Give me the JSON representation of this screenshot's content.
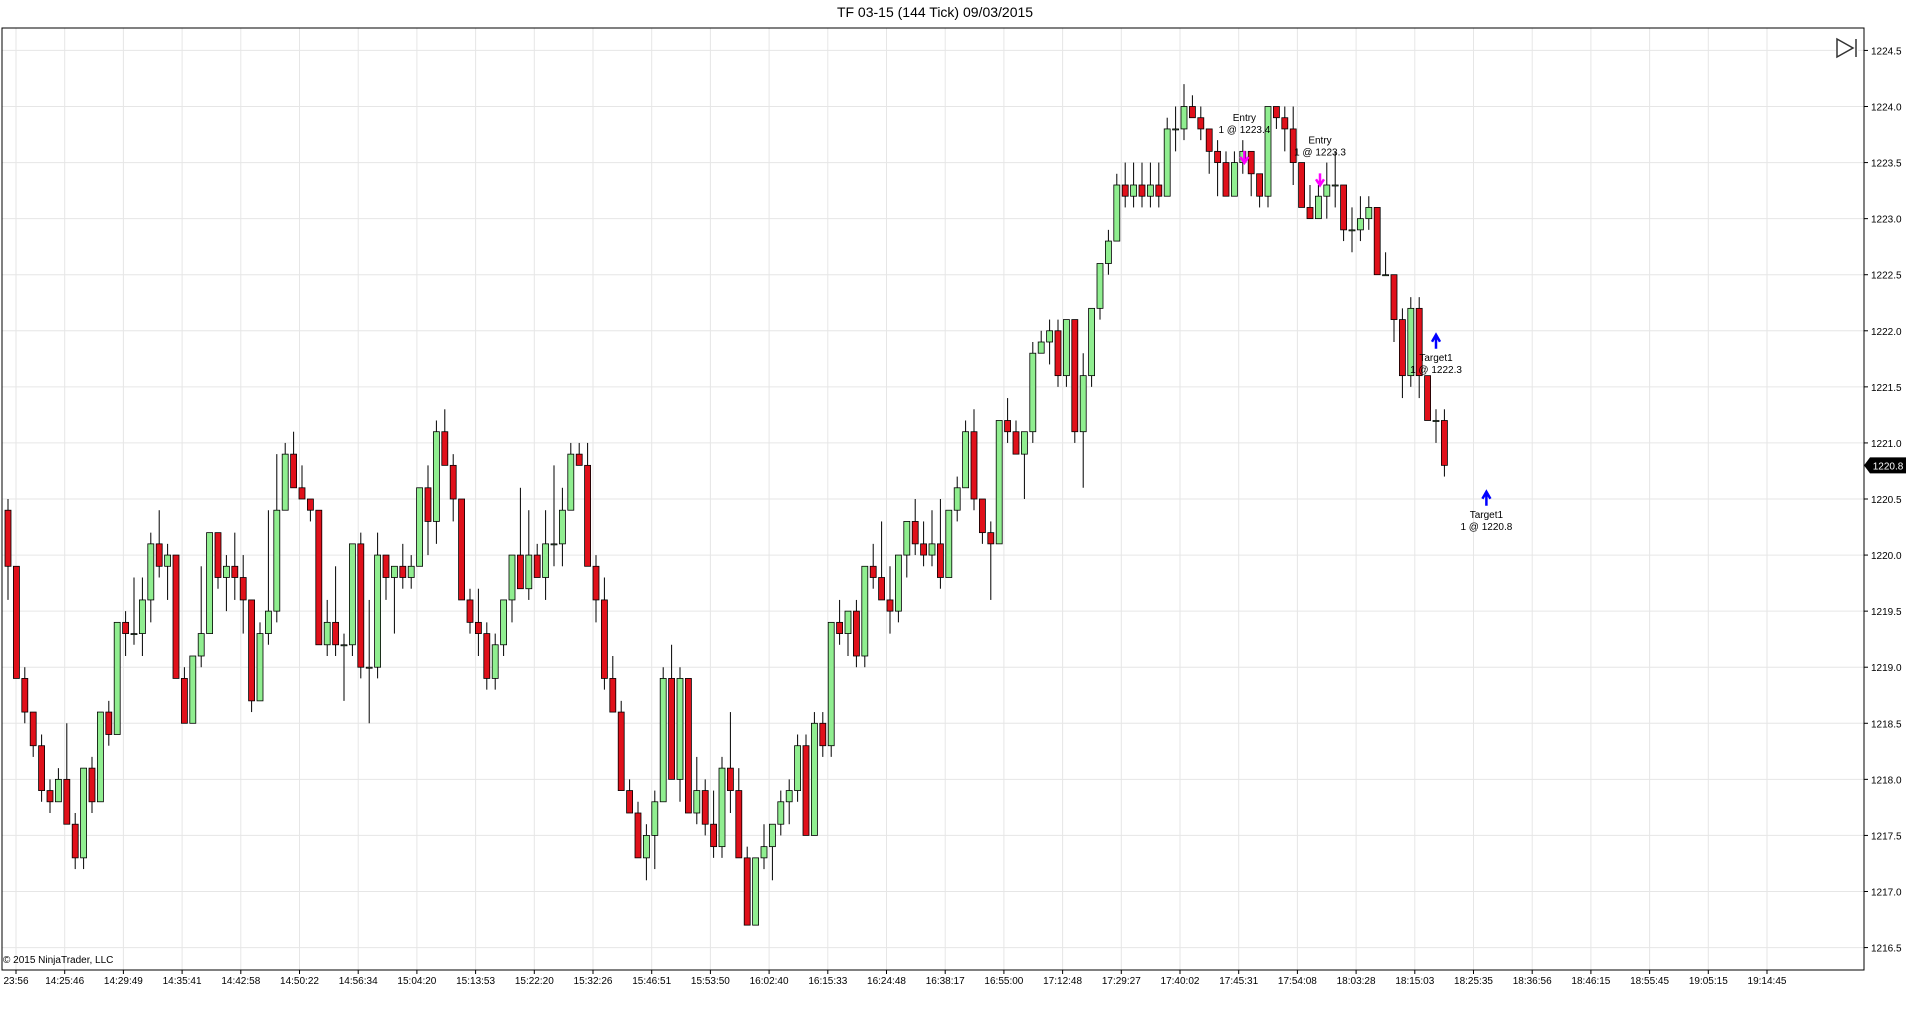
{
  "title": "TF 03-15 (144 Tick)  09/03/2015",
  "copyright": "© 2015 NinjaTrader, LLC",
  "colors": {
    "up": "#90EE90",
    "down": "#E0101A",
    "grid": "#E6E6E6",
    "border": "#000000",
    "entry_arrow": "#FF00FF",
    "target_arrow": "#0000FF",
    "last_price_bg": "#000000"
  },
  "icons": {
    "toggle_panel": "play-bar-icon"
  },
  "chart_data": {
    "type": "candlestick",
    "title": "TF 03-15 (144 Tick)  09/03/2015",
    "ylim": [
      1216.3,
      1224.7
    ],
    "yticks": [
      "1216.5",
      "1217.0",
      "1217.5",
      "1218.0",
      "1218.5",
      "1219.0",
      "1219.5",
      "1220.0",
      "1220.5",
      "1221.0",
      "1221.5",
      "1222.0",
      "1222.5",
      "1223.0",
      "1223.5",
      "1224.0",
      "1224.5"
    ],
    "xticks": [
      "23:56",
      "14:25:46",
      "14:29:49",
      "14:35:41",
      "14:42:58",
      "14:50:22",
      "14:56:34",
      "15:04:20",
      "15:13:53",
      "15:22:20",
      "15:32:26",
      "15:46:51",
      "15:53:50",
      "16:02:40",
      "16:15:33",
      "16:24:48",
      "16:38:17",
      "16:55:00",
      "17:12:48",
      "17:29:27",
      "17:40:02",
      "17:45:31",
      "17:54:08",
      "18:03:28",
      "18:15:03",
      "18:25:35",
      "18:36:56",
      "18:46:15",
      "18:55:45",
      "19:05:15",
      "19:14:45"
    ],
    "grid": true,
    "last_price": "1220.8",
    "candles": [
      {
        "o": 1220.4,
        "h": 1220.5,
        "l": 1219.6,
        "c": 1219.9
      },
      {
        "o": 1219.9,
        "h": 1219.9,
        "l": 1218.9,
        "c": 1218.9
      },
      {
        "o": 1218.9,
        "h": 1219.0,
        "l": 1218.5,
        "c": 1218.6
      },
      {
        "o": 1218.6,
        "h": 1218.6,
        "l": 1218.2,
        "c": 1218.3
      },
      {
        "o": 1218.3,
        "h": 1218.4,
        "l": 1217.8,
        "c": 1217.9
      },
      {
        "o": 1217.9,
        "h": 1218.0,
        "l": 1217.7,
        "c": 1217.8
      },
      {
        "o": 1217.8,
        "h": 1218.1,
        "l": 1217.8,
        "c": 1218.0
      },
      {
        "o": 1218.0,
        "h": 1218.5,
        "l": 1217.6,
        "c": 1217.6
      },
      {
        "o": 1217.6,
        "h": 1217.7,
        "l": 1217.2,
        "c": 1217.3
      },
      {
        "o": 1217.3,
        "h": 1218.0,
        "l": 1217.2,
        "c": 1218.1
      },
      {
        "o": 1218.1,
        "h": 1218.2,
        "l": 1217.7,
        "c": 1217.8
      },
      {
        "o": 1217.8,
        "h": 1218.6,
        "l": 1217.8,
        "c": 1218.6
      },
      {
        "o": 1218.6,
        "h": 1218.7,
        "l": 1218.3,
        "c": 1218.4
      },
      {
        "o": 1218.4,
        "h": 1219.4,
        "l": 1218.4,
        "c": 1219.4
      },
      {
        "o": 1219.4,
        "h": 1219.5,
        "l": 1219.1,
        "c": 1219.3
      },
      {
        "o": 1219.3,
        "h": 1219.8,
        "l": 1219.2,
        "c": 1219.3
      },
      {
        "o": 1219.3,
        "h": 1219.8,
        "l": 1219.1,
        "c": 1219.6
      },
      {
        "o": 1219.6,
        "h": 1220.2,
        "l": 1219.4,
        "c": 1220.1
      },
      {
        "o": 1220.1,
        "h": 1220.4,
        "l": 1219.8,
        "c": 1219.9
      },
      {
        "o": 1219.9,
        "h": 1220.1,
        "l": 1219.6,
        "c": 1220.0
      },
      {
        "o": 1220.0,
        "h": 1220.0,
        "l": 1218.9,
        "c": 1218.9
      },
      {
        "o": 1218.9,
        "h": 1219.0,
        "l": 1218.5,
        "c": 1218.5
      },
      {
        "o": 1218.5,
        "h": 1219.1,
        "l": 1218.5,
        "c": 1219.1
      },
      {
        "o": 1219.1,
        "h": 1219.9,
        "l": 1219.0,
        "c": 1219.3
      },
      {
        "o": 1219.3,
        "h": 1220.2,
        "l": 1219.3,
        "c": 1220.2
      },
      {
        "o": 1220.2,
        "h": 1220.2,
        "l": 1219.7,
        "c": 1219.8
      },
      {
        "o": 1219.8,
        "h": 1220.0,
        "l": 1219.5,
        "c": 1219.9
      },
      {
        "o": 1219.9,
        "h": 1220.2,
        "l": 1219.6,
        "c": 1219.8
      },
      {
        "o": 1219.8,
        "h": 1220.0,
        "l": 1219.3,
        "c": 1219.6
      },
      {
        "o": 1219.6,
        "h": 1219.6,
        "l": 1218.6,
        "c": 1218.7
      },
      {
        "o": 1218.7,
        "h": 1219.4,
        "l": 1218.7,
        "c": 1219.3
      },
      {
        "o": 1219.3,
        "h": 1220.4,
        "l": 1219.2,
        "c": 1219.5
      },
      {
        "o": 1219.5,
        "h": 1220.9,
        "l": 1219.4,
        "c": 1220.4
      },
      {
        "o": 1220.4,
        "h": 1221.0,
        "l": 1220.4,
        "c": 1220.9
      },
      {
        "o": 1220.9,
        "h": 1221.1,
        "l": 1220.6,
        "c": 1220.6
      },
      {
        "o": 1220.6,
        "h": 1220.8,
        "l": 1220.5,
        "c": 1220.5
      },
      {
        "o": 1220.5,
        "h": 1220.5,
        "l": 1220.3,
        "c": 1220.4
      },
      {
        "o": 1220.4,
        "h": 1220.4,
        "l": 1219.2,
        "c": 1219.2
      },
      {
        "o": 1219.2,
        "h": 1219.6,
        "l": 1219.1,
        "c": 1219.4
      },
      {
        "o": 1219.4,
        "h": 1219.9,
        "l": 1219.1,
        "c": 1219.2
      },
      {
        "o": 1219.2,
        "h": 1219.3,
        "l": 1218.7,
        "c": 1219.2
      },
      {
        "o": 1219.2,
        "h": 1219.8,
        "l": 1219.1,
        "c": 1220.1
      },
      {
        "o": 1220.1,
        "h": 1220.2,
        "l": 1218.9,
        "c": 1219.0
      },
      {
        "o": 1219.0,
        "h": 1219.6,
        "l": 1218.5,
        "c": 1219.0
      },
      {
        "o": 1219.0,
        "h": 1220.2,
        "l": 1218.9,
        "c": 1220.0
      },
      {
        "o": 1220.0,
        "h": 1220.0,
        "l": 1219.6,
        "c": 1219.8
      },
      {
        "o": 1219.8,
        "h": 1219.9,
        "l": 1219.3,
        "c": 1219.9
      },
      {
        "o": 1219.9,
        "h": 1220.1,
        "l": 1219.7,
        "c": 1219.8
      },
      {
        "o": 1219.8,
        "h": 1220.0,
        "l": 1219.7,
        "c": 1219.9
      },
      {
        "o": 1219.9,
        "h": 1220.6,
        "l": 1219.9,
        "c": 1220.6
      },
      {
        "o": 1220.6,
        "h": 1220.8,
        "l": 1220.0,
        "c": 1220.3
      },
      {
        "o": 1220.3,
        "h": 1221.2,
        "l": 1220.1,
        "c": 1221.1
      },
      {
        "o": 1221.1,
        "h": 1221.3,
        "l": 1220.9,
        "c": 1220.8
      },
      {
        "o": 1220.8,
        "h": 1220.9,
        "l": 1220.3,
        "c": 1220.5
      },
      {
        "o": 1220.5,
        "h": 1220.5,
        "l": 1219.6,
        "c": 1219.6
      },
      {
        "o": 1219.6,
        "h": 1219.7,
        "l": 1219.3,
        "c": 1219.4
      },
      {
        "o": 1219.4,
        "h": 1219.7,
        "l": 1219.1,
        "c": 1219.3
      },
      {
        "o": 1219.3,
        "h": 1219.4,
        "l": 1218.8,
        "c": 1218.9
      },
      {
        "o": 1218.9,
        "h": 1219.3,
        "l": 1218.8,
        "c": 1219.2
      },
      {
        "o": 1219.2,
        "h": 1219.5,
        "l": 1219.1,
        "c": 1219.6
      },
      {
        "o": 1219.6,
        "h": 1220.0,
        "l": 1219.4,
        "c": 1220.0
      },
      {
        "o": 1220.0,
        "h": 1220.6,
        "l": 1219.7,
        "c": 1219.7
      },
      {
        "o": 1219.7,
        "h": 1220.4,
        "l": 1219.6,
        "c": 1220.0
      },
      {
        "o": 1220.0,
        "h": 1220.1,
        "l": 1219.8,
        "c": 1219.8
      },
      {
        "o": 1219.8,
        "h": 1220.4,
        "l": 1219.6,
        "c": 1220.1
      },
      {
        "o": 1220.1,
        "h": 1220.8,
        "l": 1219.9,
        "c": 1220.1
      },
      {
        "o": 1220.1,
        "h": 1220.6,
        "l": 1219.9,
        "c": 1220.4
      },
      {
        "o": 1220.4,
        "h": 1221.0,
        "l": 1220.4,
        "c": 1220.9
      },
      {
        "o": 1220.9,
        "h": 1221.0,
        "l": 1220.8,
        "c": 1220.8
      },
      {
        "o": 1220.8,
        "h": 1221.0,
        "l": 1219.9,
        "c": 1219.9
      },
      {
        "o": 1219.9,
        "h": 1220.0,
        "l": 1219.4,
        "c": 1219.6
      },
      {
        "o": 1219.6,
        "h": 1219.8,
        "l": 1218.8,
        "c": 1218.9
      },
      {
        "o": 1218.9,
        "h": 1219.1,
        "l": 1218.6,
        "c": 1218.6
      },
      {
        "o": 1218.6,
        "h": 1218.7,
        "l": 1217.9,
        "c": 1217.9
      },
      {
        "o": 1217.9,
        "h": 1218.0,
        "l": 1217.7,
        "c": 1217.7
      },
      {
        "o": 1217.7,
        "h": 1217.8,
        "l": 1217.3,
        "c": 1217.3
      },
      {
        "o": 1217.3,
        "h": 1217.6,
        "l": 1217.1,
        "c": 1217.5
      },
      {
        "o": 1217.5,
        "h": 1217.9,
        "l": 1217.2,
        "c": 1217.8
      },
      {
        "o": 1217.8,
        "h": 1219.0,
        "l": 1217.8,
        "c": 1218.9
      },
      {
        "o": 1218.9,
        "h": 1219.2,
        "l": 1218.0,
        "c": 1218.0
      },
      {
        "o": 1218.0,
        "h": 1219.0,
        "l": 1217.8,
        "c": 1218.9
      },
      {
        "o": 1218.9,
        "h": 1218.9,
        "l": 1217.7,
        "c": 1217.7
      },
      {
        "o": 1217.7,
        "h": 1218.2,
        "l": 1217.6,
        "c": 1217.9
      },
      {
        "o": 1217.9,
        "h": 1218.0,
        "l": 1217.5,
        "c": 1217.6
      },
      {
        "o": 1217.6,
        "h": 1217.9,
        "l": 1217.3,
        "c": 1217.4
      },
      {
        "o": 1217.4,
        "h": 1218.2,
        "l": 1217.3,
        "c": 1218.1
      },
      {
        "o": 1218.1,
        "h": 1218.6,
        "l": 1217.7,
        "c": 1217.9
      },
      {
        "o": 1217.9,
        "h": 1218.1,
        "l": 1217.3,
        "c": 1217.3
      },
      {
        "o": 1217.3,
        "h": 1217.4,
        "l": 1216.7,
        "c": 1216.7
      },
      {
        "o": 1216.7,
        "h": 1217.3,
        "l": 1216.7,
        "c": 1217.3
      },
      {
        "o": 1217.3,
        "h": 1217.6,
        "l": 1217.2,
        "c": 1217.4
      },
      {
        "o": 1217.4,
        "h": 1217.6,
        "l": 1217.1,
        "c": 1217.6
      },
      {
        "o": 1217.6,
        "h": 1217.9,
        "l": 1217.5,
        "c": 1217.8
      },
      {
        "o": 1217.8,
        "h": 1218.0,
        "l": 1217.6,
        "c": 1217.9
      },
      {
        "o": 1217.9,
        "h": 1218.4,
        "l": 1217.8,
        "c": 1218.3
      },
      {
        "o": 1218.3,
        "h": 1218.4,
        "l": 1217.5,
        "c": 1217.5
      },
      {
        "o": 1217.5,
        "h": 1218.6,
        "l": 1217.5,
        "c": 1218.5
      },
      {
        "o": 1218.5,
        "h": 1218.6,
        "l": 1218.2,
        "c": 1218.3
      },
      {
        "o": 1218.3,
        "h": 1219.4,
        "l": 1218.2,
        "c": 1219.4
      },
      {
        "o": 1219.4,
        "h": 1219.6,
        "l": 1219.2,
        "c": 1219.3
      },
      {
        "o": 1219.3,
        "h": 1219.5,
        "l": 1219.1,
        "c": 1219.5
      },
      {
        "o": 1219.5,
        "h": 1219.6,
        "l": 1219.0,
        "c": 1219.1
      },
      {
        "o": 1219.1,
        "h": 1219.9,
        "l": 1219.0,
        "c": 1219.9
      },
      {
        "o": 1219.9,
        "h": 1220.1,
        "l": 1219.7,
        "c": 1219.8
      },
      {
        "o": 1219.8,
        "h": 1220.3,
        "l": 1219.6,
        "c": 1219.6
      },
      {
        "o": 1219.6,
        "h": 1219.9,
        "l": 1219.3,
        "c": 1219.5
      },
      {
        "o": 1219.5,
        "h": 1220.0,
        "l": 1219.4,
        "c": 1220.0
      },
      {
        "o": 1220.0,
        "h": 1220.3,
        "l": 1219.8,
        "c": 1220.3
      },
      {
        "o": 1220.3,
        "h": 1220.5,
        "l": 1220.0,
        "c": 1220.1
      },
      {
        "o": 1220.1,
        "h": 1220.3,
        "l": 1219.9,
        "c": 1220.0
      },
      {
        "o": 1220.0,
        "h": 1220.4,
        "l": 1219.9,
        "c": 1220.1
      },
      {
        "o": 1220.1,
        "h": 1220.5,
        "l": 1219.7,
        "c": 1219.8
      },
      {
        "o": 1219.8,
        "h": 1220.4,
        "l": 1219.8,
        "c": 1220.4
      },
      {
        "o": 1220.4,
        "h": 1220.7,
        "l": 1220.3,
        "c": 1220.6
      },
      {
        "o": 1220.6,
        "h": 1221.2,
        "l": 1220.6,
        "c": 1221.1
      },
      {
        "o": 1221.1,
        "h": 1221.3,
        "l": 1220.4,
        "c": 1220.5
      },
      {
        "o": 1220.5,
        "h": 1220.5,
        "l": 1220.1,
        "c": 1220.2
      },
      {
        "o": 1220.2,
        "h": 1220.3,
        "l": 1219.6,
        "c": 1220.1
      },
      {
        "o": 1220.1,
        "h": 1221.2,
        "l": 1220.1,
        "c": 1221.2
      },
      {
        "o": 1221.2,
        "h": 1221.4,
        "l": 1221.0,
        "c": 1221.1
      },
      {
        "o": 1221.1,
        "h": 1221.2,
        "l": 1220.9,
        "c": 1220.9
      },
      {
        "o": 1220.9,
        "h": 1221.1,
        "l": 1220.5,
        "c": 1221.1
      },
      {
        "o": 1221.1,
        "h": 1221.9,
        "l": 1221.0,
        "c": 1221.8
      },
      {
        "o": 1221.8,
        "h": 1222.0,
        "l": 1221.8,
        "c": 1221.9
      },
      {
        "o": 1221.9,
        "h": 1222.1,
        "l": 1221.7,
        "c": 1222.0
      },
      {
        "o": 1222.0,
        "h": 1222.1,
        "l": 1221.5,
        "c": 1221.6
      },
      {
        "o": 1221.6,
        "h": 1222.0,
        "l": 1221.5,
        "c": 1222.1
      },
      {
        "o": 1222.1,
        "h": 1222.1,
        "l": 1221.0,
        "c": 1221.1
      },
      {
        "o": 1221.1,
        "h": 1221.8,
        "l": 1220.6,
        "c": 1221.6
      },
      {
        "o": 1221.6,
        "h": 1222.2,
        "l": 1221.5,
        "c": 1222.2
      },
      {
        "o": 1222.2,
        "h": 1222.6,
        "l": 1222.1,
        "c": 1222.6
      },
      {
        "o": 1222.6,
        "h": 1222.9,
        "l": 1222.5,
        "c": 1222.8
      },
      {
        "o": 1222.8,
        "h": 1223.4,
        "l": 1222.8,
        "c": 1223.3
      },
      {
        "o": 1223.3,
        "h": 1223.5,
        "l": 1223.1,
        "c": 1223.2
      },
      {
        "o": 1223.2,
        "h": 1223.5,
        "l": 1223.1,
        "c": 1223.3
      },
      {
        "o": 1223.3,
        "h": 1223.5,
        "l": 1223.1,
        "c": 1223.2
      },
      {
        "o": 1223.2,
        "h": 1223.5,
        "l": 1223.1,
        "c": 1223.3
      },
      {
        "o": 1223.3,
        "h": 1223.5,
        "l": 1223.1,
        "c": 1223.2
      },
      {
        "o": 1223.2,
        "h": 1223.9,
        "l": 1223.2,
        "c": 1223.8
      },
      {
        "o": 1223.8,
        "h": 1224.0,
        "l": 1223.6,
        "c": 1223.8
      },
      {
        "o": 1223.8,
        "h": 1224.2,
        "l": 1223.7,
        "c": 1224.0
      },
      {
        "o": 1224.0,
        "h": 1224.1,
        "l": 1223.9,
        "c": 1223.9
      },
      {
        "o": 1223.9,
        "h": 1224.0,
        "l": 1223.7,
        "c": 1223.8
      },
      {
        "o": 1223.8,
        "h": 1223.8,
        "l": 1223.4,
        "c": 1223.6
      },
      {
        "o": 1223.6,
        "h": 1223.7,
        "l": 1223.2,
        "c": 1223.5
      },
      {
        "o": 1223.5,
        "h": 1223.6,
        "l": 1223.2,
        "c": 1223.2
      },
      {
        "o": 1223.2,
        "h": 1223.6,
        "l": 1223.2,
        "c": 1223.5
      },
      {
        "o": 1223.5,
        "h": 1223.7,
        "l": 1223.4,
        "c": 1223.6
      },
      {
        "o": 1223.6,
        "h": 1223.6,
        "l": 1223.2,
        "c": 1223.4
      },
      {
        "o": 1223.4,
        "h": 1223.4,
        "l": 1223.1,
        "c": 1223.2
      },
      {
        "o": 1223.2,
        "h": 1224.0,
        "l": 1223.1,
        "c": 1224.0
      },
      {
        "o": 1224.0,
        "h": 1224.0,
        "l": 1223.8,
        "c": 1223.9
      },
      {
        "o": 1223.9,
        "h": 1224.0,
        "l": 1223.6,
        "c": 1223.8
      },
      {
        "o": 1223.8,
        "h": 1224.0,
        "l": 1223.3,
        "c": 1223.5
      },
      {
        "o": 1223.5,
        "h": 1223.5,
        "l": 1223.1,
        "c": 1223.1
      },
      {
        "o": 1223.1,
        "h": 1223.3,
        "l": 1223.0,
        "c": 1223.0
      },
      {
        "o": 1223.0,
        "h": 1223.3,
        "l": 1223.0,
        "c": 1223.2
      },
      {
        "o": 1223.2,
        "h": 1223.5,
        "l": 1223.0,
        "c": 1223.3
      },
      {
        "o": 1223.3,
        "h": 1223.6,
        "l": 1223.1,
        "c": 1223.3
      },
      {
        "o": 1223.3,
        "h": 1223.3,
        "l": 1222.8,
        "c": 1222.9
      },
      {
        "o": 1222.9,
        "h": 1223.1,
        "l": 1222.7,
        "c": 1222.9
      },
      {
        "o": 1222.9,
        "h": 1223.2,
        "l": 1222.8,
        "c": 1223.0
      },
      {
        "o": 1223.0,
        "h": 1223.2,
        "l": 1222.9,
        "c": 1223.1
      },
      {
        "o": 1223.1,
        "h": 1223.1,
        "l": 1222.5,
        "c": 1222.5
      },
      {
        "o": 1222.5,
        "h": 1222.7,
        "l": 1222.5,
        "c": 1222.5
      },
      {
        "o": 1222.5,
        "h": 1222.5,
        "l": 1221.9,
        "c": 1222.1
      },
      {
        "o": 1222.1,
        "h": 1222.2,
        "l": 1221.4,
        "c": 1221.6
      },
      {
        "o": 1221.6,
        "h": 1222.3,
        "l": 1221.5,
        "c": 1222.2
      },
      {
        "o": 1222.2,
        "h": 1222.3,
        "l": 1221.4,
        "c": 1221.6
      },
      {
        "o": 1221.6,
        "h": 1221.6,
        "l": 1221.2,
        "c": 1221.2
      },
      {
        "o": 1221.2,
        "h": 1221.3,
        "l": 1221.0,
        "c": 1221.2
      },
      {
        "o": 1221.2,
        "h": 1221.3,
        "l": 1220.7,
        "c": 1220.8
      }
    ],
    "annotations": [
      {
        "type": "entry",
        "candle": 146,
        "price": 1223.8,
        "label1": "Entry",
        "label2": "1 @ 1223.4"
      },
      {
        "type": "entry",
        "candle": 155,
        "price": 1223.6,
        "label1": "Entry",
        "label2": "1 @ 1223.3"
      },
      {
        "type": "target",
        "candle": 170,
        "price": 1222.0,
        "label1": "Target1",
        "label2": "1 @ 1222.3"
      },
      {
        "type": "target",
        "candle": 176,
        "price": 1220.6,
        "label1": "Target1",
        "label2": "1 @ 1220.8"
      }
    ]
  }
}
